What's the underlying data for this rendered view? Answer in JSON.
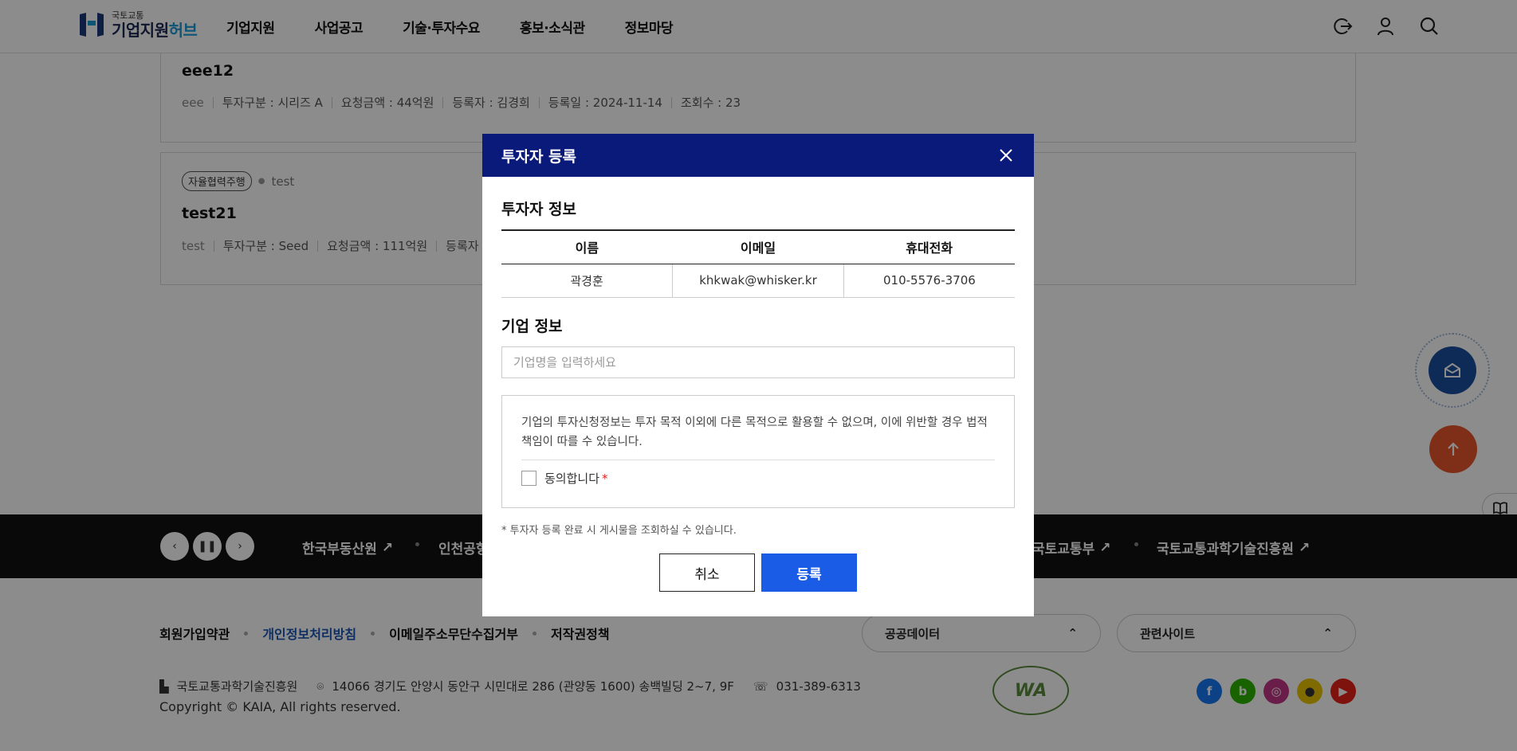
{
  "header": {
    "logo_small": "국토교통",
    "logo_main": "기업지원",
    "logo_accent": "허브",
    "nav": [
      "기업지원",
      "사업공고",
      "기술·투자수요",
      "홍보·소식관",
      "정보마당"
    ]
  },
  "posts": [
    {
      "title": "eee12",
      "meta": [
        "eee",
        "투자구분 : 시리즈 A",
        "요청금액 : 44억원",
        "등록자 : 김경희",
        "등록일 : 2024-11-14",
        "조회수 : 23"
      ]
    },
    {
      "tag": "자율협력주행",
      "category": "test",
      "title": "test21",
      "meta": [
        "test",
        "투자구분 : Seed",
        "요청금액 : 111억원",
        "등록자 :"
      ]
    }
  ],
  "banner": {
    "items": [
      "한국부동산원",
      "인천공항",
      "국토교통부",
      "국토교통과학기술진흥원"
    ]
  },
  "footer": {
    "links": [
      "회원가입약관",
      "개인정보처리방침",
      "이메일주소무단수집거부",
      "저작권정책"
    ],
    "public_data": "공공데이터",
    "related_sites": "관련사이트",
    "org": "국토교통과학기술진흥원",
    "address": "14066 경기도 안양시 동안구 시민대로 286 (관양동 1600) 송백빌딩 2~7, 9F",
    "phone": "031-389-6313",
    "copyright": "Copyright © KAIA, All rights reserved.",
    "wa_mark": "WA"
  },
  "modal": {
    "title": "투자자 등록",
    "investor_section": "투자자 정보",
    "columns": [
      "이름",
      "이메일",
      "휴대전화"
    ],
    "investor": {
      "name": "곽경훈",
      "email": "khkwak@whisker.kr",
      "phone": "010-5576-3706"
    },
    "company_section": "기업 정보",
    "company_placeholder": "기업명을 입력하세요",
    "agreement_text": "기업의 투자신청정보는 투자 목적 이외에 다른 목적으로 활용할 수 없으며, 이에 위반할 경우 법적 책임이 따를 수 있습니다.",
    "agree_label": "동의합니다",
    "required_mark": "*",
    "note": "* 투자자 등록 완료 시 게시물을 조회하실 수 있습니다.",
    "cancel": "취소",
    "submit": "등록"
  },
  "colors": {
    "modal_header": "#0a1a7a",
    "submit_button": "#1b5ce6",
    "top_button": "#e8572a",
    "newsletter": "#1a4fa0"
  }
}
